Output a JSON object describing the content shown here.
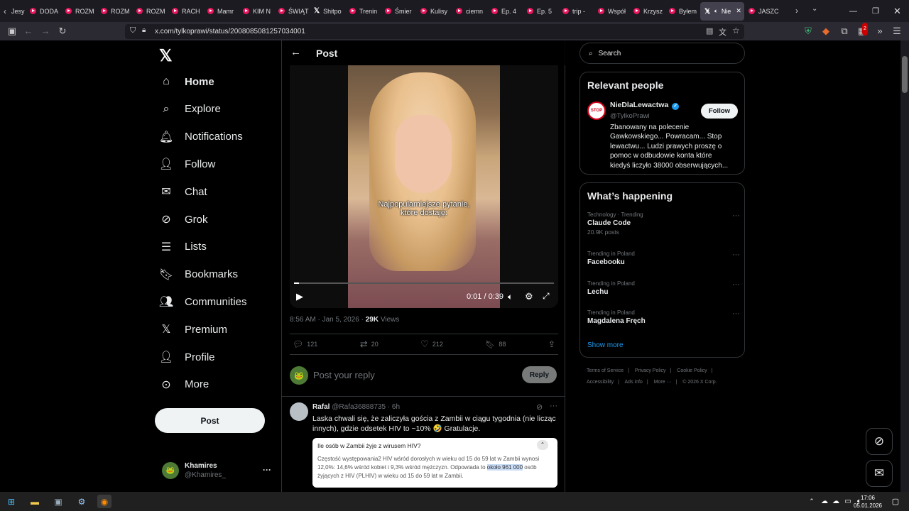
{
  "browser": {
    "tabs": [
      {
        "label": "Jesy",
        "type": "partial"
      },
      {
        "label": "DODA",
        "type": "yt"
      },
      {
        "label": "ROZM",
        "type": "yt"
      },
      {
        "label": "ROZM",
        "type": "yt"
      },
      {
        "label": "ROZM",
        "type": "yt"
      },
      {
        "label": "RACH",
        "type": "yt"
      },
      {
        "label": "Mamr",
        "type": "yt"
      },
      {
        "label": "KIM N",
        "type": "yt"
      },
      {
        "label": "ŚWIĄT",
        "type": "yt"
      },
      {
        "label": "Shitpo",
        "type": "x"
      },
      {
        "label": "Trenin",
        "type": "yt"
      },
      {
        "label": "Śmier",
        "type": "yt"
      },
      {
        "label": "Kulisy",
        "type": "yt"
      },
      {
        "label": "ciemn",
        "type": "yt"
      },
      {
        "label": "Ep. 4",
        "type": "yt"
      },
      {
        "label": "Ep. 5",
        "type": "yt"
      },
      {
        "label": "trip -",
        "type": "yt"
      },
      {
        "label": "Współ",
        "type": "yt"
      },
      {
        "label": "Krzysz",
        "type": "yt"
      },
      {
        "label": "Byłem",
        "type": "yt"
      },
      {
        "label": "Nie",
        "type": "active"
      },
      {
        "label": "JASZC",
        "type": "yt"
      }
    ],
    "url": "x.com/tylkoprawi/status/2008085081257034001",
    "notif_badge": "2"
  },
  "sidebar": {
    "items": [
      {
        "label": "Home",
        "icon": "home-icon"
      },
      {
        "label": "Explore",
        "icon": "search-icon"
      },
      {
        "label": "Notifications",
        "icon": "bell-icon"
      },
      {
        "label": "Follow",
        "icon": "person-add-icon"
      },
      {
        "label": "Chat",
        "icon": "mail-icon"
      },
      {
        "label": "Grok",
        "icon": "grok-icon"
      },
      {
        "label": "Lists",
        "icon": "list-icon"
      },
      {
        "label": "Bookmarks",
        "icon": "bookmark-icon"
      },
      {
        "label": "Communities",
        "icon": "communities-icon"
      },
      {
        "label": "Premium",
        "icon": "x-icon"
      },
      {
        "label": "Profile",
        "icon": "person-icon"
      },
      {
        "label": "More",
        "icon": "more-circle-icon"
      }
    ],
    "post_label": "Post",
    "account": {
      "name": "Khamires",
      "handle": "@Khamires_"
    }
  },
  "main": {
    "header_title": "Post",
    "video": {
      "subtitle_line1": "Najpopularniejsze pytanie,",
      "subtitle_line2": "które dostaję:",
      "time": "0:01 / 0:39",
      "progress": 0.02
    },
    "meta": {
      "time": "8:56 AM · Jan 5, 2026 · ",
      "views_count": "29K",
      "views_label": " Views"
    },
    "actions": {
      "replies": "121",
      "reposts": "20",
      "likes": "212",
      "bookmarks": "88"
    },
    "reply_placeholder": "Post your reply",
    "reply_button": "Reply",
    "reply": {
      "name": "Rafal",
      "handle": "@Rafa36888735 · 6h",
      "text_line1": "Laska chwali się, że zaliczyła gościa z Zambii w ciągu tygodnia (nie licząc",
      "text_line2": "innych), gdzie odsetek HIV to ~10% 🤣 Gratulacje.",
      "ai_question": "Ile osób w Zambii żyje z wirusem HIV?",
      "ai_answer_line1": "Częstość występowania2 HIV wśród dorosłych w wieku od 15 do 59 lat w Zambii wynosi",
      "ai_answer_line2_a": "12,0%: 14,6% wśród kobiet i 9,3% wśród mężczyzn. Odpowiada to ",
      "ai_answer_highlight": "około 961 000",
      "ai_answer_line2_b": " osób",
      "ai_answer_line3": "żyjących z HIV (PLHIV) w wieku od 15 do 59 lat w Zambii."
    }
  },
  "right": {
    "search_placeholder": "Search",
    "relevant": {
      "title": "Relevant people",
      "name": "NieDlaLewactwa",
      "handle": "@TylkoPrawi",
      "follow": "Follow",
      "bio_lines": [
        "Zbanowany na polecenie",
        "Gawkowskiego... Powracam... Stop",
        "lewactwu... Ludzi prawych proszę o",
        "pomoc w odbudowie konta które",
        "kiedyś liczyło 38000 obserwujących..."
      ],
      "avatar_text": "STOP"
    },
    "happening": {
      "title": "What’s happening",
      "trends": [
        {
          "category": "Technology · Trending",
          "name": "Claude Code",
          "count": "20.9K posts"
        },
        {
          "category": "Trending in Poland",
          "name": "Facebooku",
          "count": ""
        },
        {
          "category": "Trending in Poland",
          "name": "Lechu",
          "count": ""
        },
        {
          "category": "Trending in Poland",
          "name": "Magdalena Fręch",
          "count": ""
        }
      ],
      "show_more": "Show more"
    },
    "footer": {
      "terms": "Terms of Service",
      "privacy": "Privacy Policy",
      "cookie": "Cookie Policy",
      "accessibility": "Accessibility",
      "ads": "Ads info",
      "more": "More ···",
      "copyright": "© 2026 X Corp."
    }
  },
  "taskbar": {
    "time": "17:06",
    "date": "05.01.2026"
  }
}
